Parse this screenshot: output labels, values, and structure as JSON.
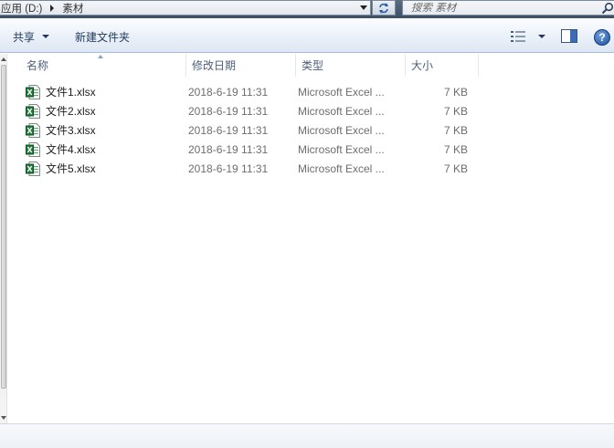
{
  "address_bar": {
    "crumbs": [
      "应用 (D:)",
      "素材"
    ]
  },
  "search": {
    "placeholder": "搜索 素材"
  },
  "toolbar": {
    "share_label": "共享",
    "new_folder_label": "新建文件夹",
    "help_label": "?"
  },
  "columns": {
    "name": "名称",
    "date": "修改日期",
    "type": "类型",
    "size": "大小"
  },
  "files": [
    {
      "name": "文件1.xlsx",
      "date": "2018-6-19 11:31",
      "type": "Microsoft Excel ...",
      "size": "7 KB"
    },
    {
      "name": "文件2.xlsx",
      "date": "2018-6-19 11:31",
      "type": "Microsoft Excel ...",
      "size": "7 KB"
    },
    {
      "name": "文件3.xlsx",
      "date": "2018-6-19 11:31",
      "type": "Microsoft Excel ...",
      "size": "7 KB"
    },
    {
      "name": "文件4.xlsx",
      "date": "2018-6-19 11:31",
      "type": "Microsoft Excel ...",
      "size": "7 KB"
    },
    {
      "name": "文件5.xlsx",
      "date": "2018-6-19 11:31",
      "type": "Microsoft Excel ...",
      "size": "7 KB"
    }
  ],
  "icons": {
    "file": "excel-file-icon",
    "search": "search-icon",
    "refresh": "refresh-icon",
    "views": "view-options-icon",
    "preview": "preview-pane-icon",
    "help": "help-icon"
  },
  "colors": {
    "toolbar_text": "#1e395b",
    "header_text": "#4c607a",
    "excel_green": "#1f7a3a"
  }
}
